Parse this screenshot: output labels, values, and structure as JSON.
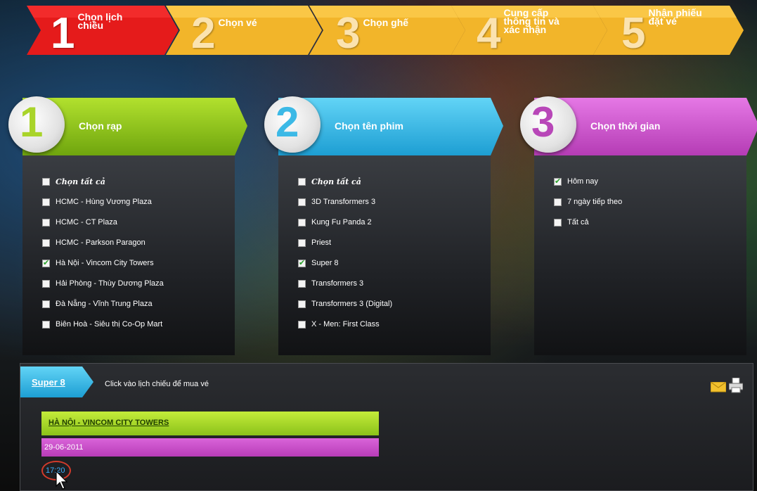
{
  "steps": [
    {
      "num": "1",
      "label": "Chọn lịch chiều"
    },
    {
      "num": "2",
      "label": "Chọn vé"
    },
    {
      "num": "3",
      "label": "Chọn ghế"
    },
    {
      "num": "4",
      "label": "Cung cấp thông tin và xác nhận"
    },
    {
      "num": "5",
      "label": "Nhận phiếu đặt vé"
    }
  ],
  "panels": {
    "theater": {
      "num": "1",
      "title": "Chọn rạp",
      "items": [
        {
          "label": "Chọn tất cả",
          "checked": false
        },
        {
          "label": "HCMC - Hùng Vương Plaza",
          "checked": false
        },
        {
          "label": "HCMC - CT Plaza",
          "checked": false
        },
        {
          "label": "HCMC - Parkson Paragon",
          "checked": false
        },
        {
          "label": "Hà Nội - Vincom City Towers",
          "checked": true
        },
        {
          "label": "Hải Phòng - Thùy Dương Plaza",
          "checked": false
        },
        {
          "label": "Đà Nẵng - Vĩnh Trung Plaza",
          "checked": false
        },
        {
          "label": "Biên Hoà - Siêu thị Co-Op Mart",
          "checked": false
        }
      ]
    },
    "movie": {
      "num": "2",
      "title": "Chọn tên phim",
      "items": [
        {
          "label": "Chọn tất cả",
          "checked": false
        },
        {
          "label": "3D Transformers 3",
          "checked": false
        },
        {
          "label": "Kung Fu Panda 2",
          "checked": false
        },
        {
          "label": "Priest",
          "checked": false
        },
        {
          "label": "Super 8",
          "checked": true
        },
        {
          "label": "Transformers 3",
          "checked": false
        },
        {
          "label": "Transformers 3 (Digital)",
          "checked": false
        },
        {
          "label": "X - Men: First Class",
          "checked": false
        }
      ]
    },
    "time": {
      "num": "3",
      "title": "Chọn thời gian",
      "items": [
        {
          "label": "Hôm nay",
          "checked": true
        },
        {
          "label": "7 ngày tiếp theo",
          "checked": false
        },
        {
          "label": "Tất cả",
          "checked": false
        }
      ]
    }
  },
  "schedule": {
    "film_tab": "Super 8",
    "hint": "Click vào lịch chiếu để mua vé",
    "venue": "HÀ NỘI - VINCOM CITY TOWERS",
    "date": "29-06-2011",
    "time": "17:20",
    "tools": [
      "email-icon",
      "print-icon"
    ]
  },
  "colors": {
    "step_active": "#e51b1b",
    "step_inactive": "#f2b52a",
    "panel1": "#8cc31a",
    "panel2": "#2bb7e8",
    "panel3": "#c94ac9",
    "time_text": "#3ab0ff"
  }
}
